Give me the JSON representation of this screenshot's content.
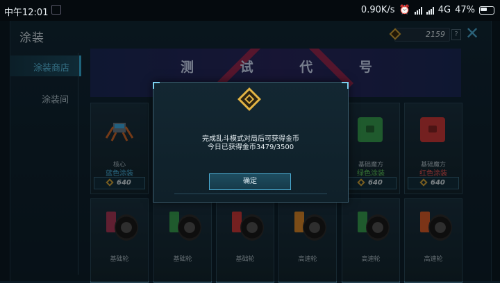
{
  "status_bar": {
    "time": "中午12:01",
    "network_speed": "0.90K/s",
    "network_type": "4G",
    "battery": "47%"
  },
  "header": {
    "title": "涂装",
    "coins": "2159",
    "help_label": "?",
    "close_icon": "close-icon"
  },
  "sidebar": {
    "items": [
      {
        "label": "涂装商店",
        "active": true
      },
      {
        "label": "涂装间",
        "active": false
      }
    ]
  },
  "banner": {
    "text": "测 试 代 号"
  },
  "shop_items_row1": [
    {
      "name": "核心",
      "skin": "蓝色涂装",
      "skin_color": "#4fc0ee",
      "price": "640"
    },
    {
      "name": "基础魔方",
      "skin": "绿色涂装",
      "skin_color": "#63d35f",
      "price": "640"
    },
    {
      "name": "基础魔方",
      "skin": "红色涂装",
      "skin_color": "#ff5a5a",
      "price": "640"
    }
  ],
  "shop_items_row2": [
    {
      "name": "基础轮"
    },
    {
      "name": "基础轮"
    },
    {
      "name": "基础轮"
    },
    {
      "name": "高速轮"
    },
    {
      "name": "高速轮"
    },
    {
      "name": "高速轮"
    }
  ],
  "dialog": {
    "line1": "完成乱斗模式对局后可获得金币",
    "line2": "今日已获得金币3479/3500",
    "confirm_label": "确定"
  }
}
